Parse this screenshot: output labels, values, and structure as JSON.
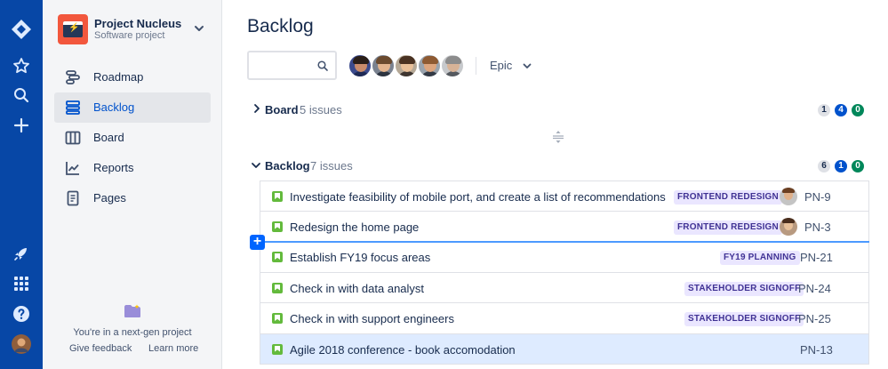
{
  "global_nav": {
    "items": [
      "jira-logo-icon",
      "star-icon",
      "search-icon",
      "plus-icon",
      "rocket-icon",
      "app-switcher-icon",
      "help-icon",
      "user-avatar"
    ]
  },
  "project": {
    "name": "Project Nucleus",
    "type": "Software project"
  },
  "sidebar": {
    "items": [
      {
        "label": "Roadmap",
        "icon": "roadmap-icon"
      },
      {
        "label": "Backlog",
        "icon": "backlog-icon",
        "active": true
      },
      {
        "label": "Board",
        "icon": "board-icon"
      },
      {
        "label": "Reports",
        "icon": "reports-icon"
      },
      {
        "label": "Pages",
        "icon": "pages-icon"
      }
    ],
    "footer": {
      "text": "You're in a next-gen project",
      "feedback": "Give feedback",
      "learn": "Learn more"
    }
  },
  "page": {
    "title": "Backlog"
  },
  "filters": {
    "search_value": "",
    "epic_label": "Epic"
  },
  "board_section": {
    "title": "Board",
    "count": "5 issues",
    "todo": "1",
    "in_progress": "4",
    "done": "0"
  },
  "backlog_section": {
    "title": "Backlog",
    "count": "7 issues",
    "todo": "6",
    "in_progress": "1",
    "done": "0"
  },
  "issues": [
    {
      "summary": "Investigate feasibility of mobile port, and create a list of recommendations",
      "epic": "FRONTEND REDESIGN",
      "key": "PN-9",
      "assignee": true
    },
    {
      "summary": "Redesign the home page",
      "epic": "FRONTEND REDESIGN",
      "key": "PN-3",
      "assignee": true
    },
    {
      "summary": "Establish FY19 focus areas",
      "epic": "FY19 PLANNING",
      "key": "PN-21",
      "assignee": false
    },
    {
      "summary": "Check in with data analyst",
      "epic": "STAKEHOLDER SIGNOFF",
      "key": "PN-24",
      "assignee": false
    },
    {
      "summary": "Check in with support engineers",
      "epic": "STAKEHOLDER SIGNOFF",
      "key": "PN-25",
      "assignee": false
    },
    {
      "summary": "Agile 2018 conference - book accomodation",
      "epic": "",
      "key": "PN-13",
      "assignee": false,
      "selected": true
    }
  ],
  "colors": {
    "global_nav": "#0747A6",
    "accent": "#0052CC",
    "story": "#63BA3C",
    "epic_bg": "#EAE6FF",
    "epic_text": "#403294",
    "selected_row": "#DEEBFF"
  }
}
